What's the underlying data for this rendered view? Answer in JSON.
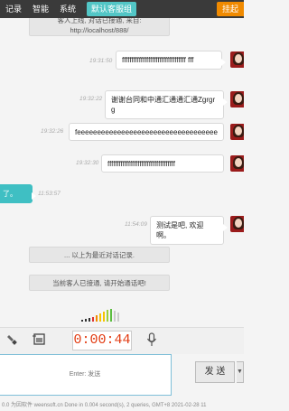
{
  "topbar": {
    "tabs": [
      "记录",
      "智能",
      "系统"
    ],
    "active_tab": "默认客服组",
    "right_button": "挂起"
  },
  "messages": {
    "sys_top": "客人上线, 对话已接通, 来自: http://localhost/888/",
    "m1_time": "19:31:50",
    "m1_text": "ffffffffffffffffffffffffffffffffff fff",
    "m2_time": "19:32:22",
    "m2_text": "谢谢台同和中通汇通通汇通Zgrgrg",
    "m3_time": "19:32:26",
    "m3_text": "feeeeeeeeeeeeeeeeeeeeeeeeeeeeeeeeeeeeeeeeeeeeeeeeeeeeeeeeeeee",
    "m4_time": "19:32:30",
    "m4_text": "ffffffffffffffffffffffffffffffffffff",
    "m5_text": "了。",
    "m5_time": "11:53:57",
    "m6_time": "11:54:09",
    "m6_text": "测试是吧, 欢迎啊。",
    "sys_history": "... 以上为最近对话记录.",
    "sys_connected": "当前客人已接通, 请开始通话吧!"
  },
  "toolbar": {
    "timer": "0:00:44",
    "left_icon": "flashlight-icon",
    "screenshot_icon": "screenshot-icon",
    "mic_icon": "microphone-icon"
  },
  "input": {
    "placeholder": "Enter: 发送"
  },
  "send": {
    "label": "发 送",
    "arrow": "▼"
  },
  "footer": {
    "text": "0.0 为因软件 weensoft.cn Done in 0.004 second(s), 2 queries, GMT+8 2021-02-28 11"
  },
  "colors": {
    "accent": "#3fbfc3",
    "timer": "#e23a10",
    "topbar": "#3a3a3a",
    "hangup": "#f08a00"
  }
}
